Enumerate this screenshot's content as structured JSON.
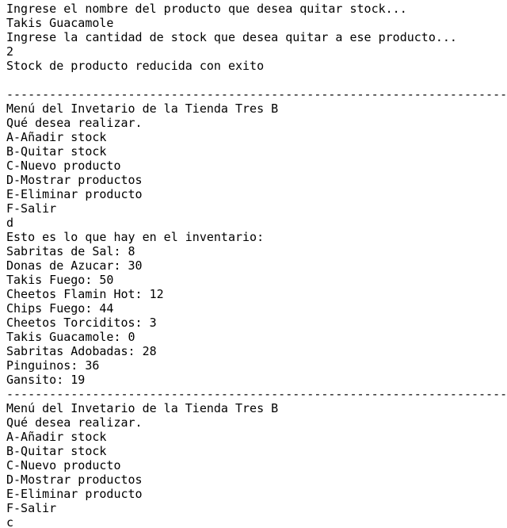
{
  "terminal": {
    "lines_top": [
      "Ingrese el nombre del producto que desea quitar stock...",
      "Takis Guacamole",
      "Ingrese la cantidad de stock que desea quitar a ese producto...",
      "2",
      "Stock de producto reducida con exito",
      ""
    ],
    "divider_1": "--------------------------------------------------------------------------------",
    "menu_1": {
      "title": "Menú del Invetario de la Tienda Tres B",
      "prompt": "Qué desea realizar.",
      "options": [
        "A-Añadir stock",
        "B-Quitar stock",
        "C-Nuevo producto",
        "D-Mostrar productos",
        "E-Eliminar producto",
        "F-Salir"
      ],
      "input": "d"
    },
    "inventory": {
      "header": "Esto es lo que hay en el inventario:",
      "items": [
        "Sabritas de Sal: 8",
        "Donas de Azucar: 30",
        "Takis Fuego: 50",
        "Cheetos Flamin Hot: 12",
        "Chips Fuego: 44",
        "Cheetos Torciditos: 3",
        "Takis Guacamole: 0",
        "Sabritas Adobadas: 28",
        "Pinguinos: 36",
        "Gansito: 19"
      ]
    },
    "divider_2": "--------------------------------------------------------------------------------",
    "menu_2": {
      "title": "Menú del Invetario de la Tienda Tres B",
      "prompt": "Qué desea realizar.",
      "options": [
        "A-Añadir stock",
        "B-Quitar stock",
        "C-Nuevo producto",
        "D-Mostrar productos",
        "E-Eliminar producto",
        "F-Salir"
      ],
      "input": "c"
    }
  }
}
